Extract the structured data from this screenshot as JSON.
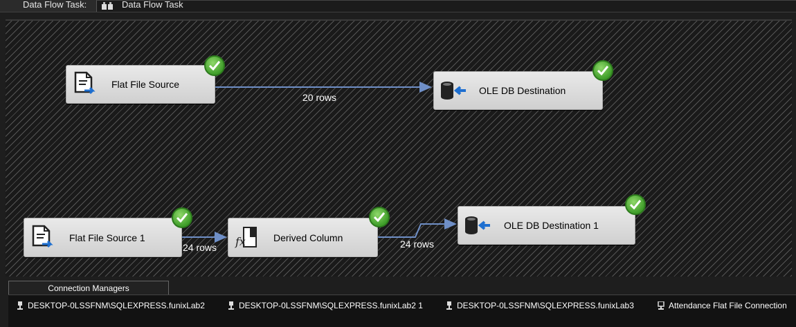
{
  "header": {
    "label": "Data Flow Task:",
    "selected_task": "Data Flow Task"
  },
  "components": {
    "flat_file_source": "Flat File Source",
    "ole_db_destination": "OLE DB Destination",
    "flat_file_source_1": "Flat File Source 1",
    "derived_column": "Derived Column",
    "ole_db_destination_1": "OLE DB Destination 1"
  },
  "paths": {
    "path1": "20 rows",
    "path2": "24 rows",
    "path3": "24 rows"
  },
  "status": {
    "all_components": "success"
  },
  "connection_managers": {
    "tab_label": "Connection Managers",
    "items": [
      "DESKTOP-0LSSFNM\\SQLEXPRESS.funixLab2",
      "DESKTOP-0LSSFNM\\SQLEXPRESS.funixLab2 1",
      "DESKTOP-0LSSFNM\\SQLEXPRESS.funixLab3",
      "Attendance Flat File Connection"
    ]
  },
  "colors": {
    "path_line": "#6f8fc7",
    "success_check": "#4caf2a"
  }
}
